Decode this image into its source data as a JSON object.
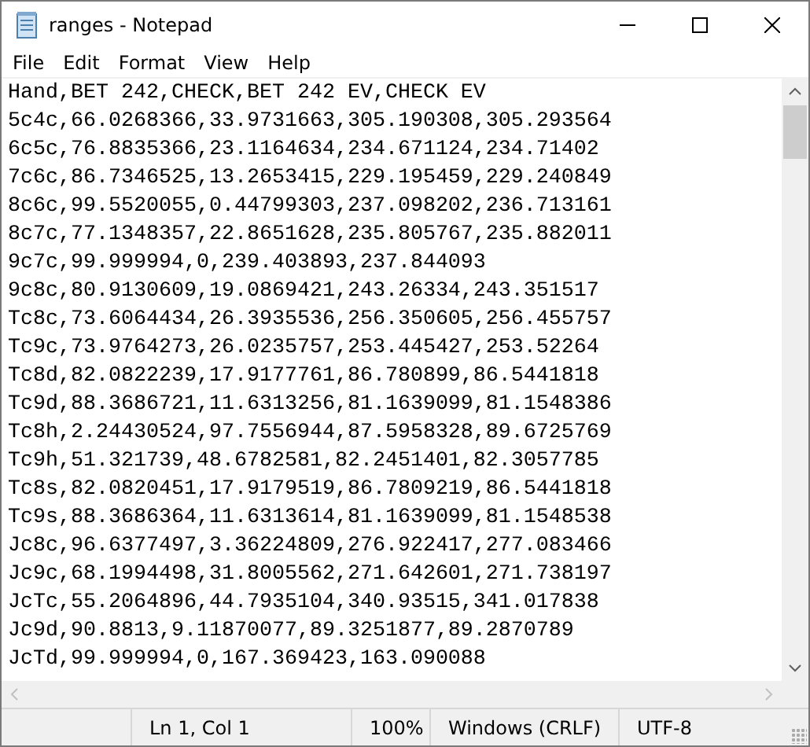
{
  "window": {
    "title": "ranges - Notepad"
  },
  "menu": [
    {
      "label": "File"
    },
    {
      "label": "Edit"
    },
    {
      "label": "Format"
    },
    {
      "label": "View"
    },
    {
      "label": "Help"
    }
  ],
  "editor": {
    "lines": [
      "Hand,BET 242,CHECK,BET 242 EV,CHECK EV",
      "5c4c,66.0268366,33.9731663,305.190308,305.293564",
      "6c5c,76.8835366,23.1164634,234.671124,234.71402",
      "7c6c,86.7346525,13.2653415,229.195459,229.240849",
      "8c6c,99.5520055,0.44799303,237.098202,236.713161",
      "8c7c,77.1348357,22.8651628,235.805767,235.882011",
      "9c7c,99.999994,0,239.403893,237.844093",
      "9c8c,80.9130609,19.0869421,243.26334,243.351517",
      "Tc8c,73.6064434,26.3935536,256.350605,256.455757",
      "Tc9c,73.9764273,26.0235757,253.445427,253.52264",
      "Tc8d,82.0822239,17.9177761,86.780899,86.5441818",
      "Tc9d,88.3686721,11.6313256,81.1639099,81.1548386",
      "Tc8h,2.24430524,97.7556944,87.5958328,89.6725769",
      "Tc9h,51.321739,48.6782581,82.2451401,82.3057785",
      "Tc8s,82.0820451,17.9179519,86.7809219,86.5441818",
      "Tc9s,88.3686364,11.6313614,81.1639099,81.1548538",
      "Jc8c,96.6377497,3.36224809,276.922417,277.083466",
      "Jc9c,68.1994498,31.8005562,271.642601,271.738197",
      "JcTc,55.2064896,44.7935104,340.93515,341.017838",
      "Jc9d,90.8813,9.11870077,89.3251877,89.2870789",
      "JcTd,99.999994,0,167.369423,163.090088"
    ]
  },
  "status_bar": {
    "position": "Ln 1, Col 1",
    "zoom": "100%",
    "line_ending": "Windows (CRLF)",
    "encoding": "UTF-8"
  }
}
